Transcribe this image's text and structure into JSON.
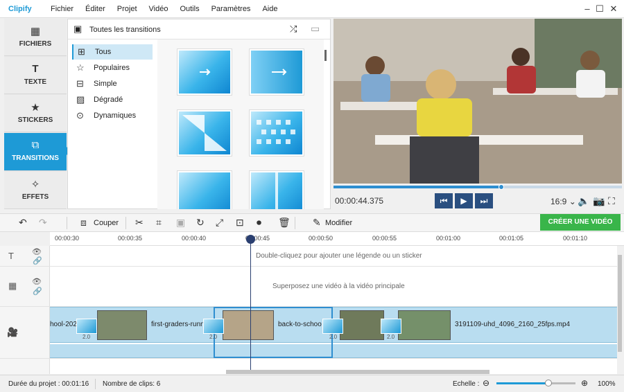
{
  "app": {
    "logo": "Clipify"
  },
  "menu": [
    "Fichier",
    "Éditer",
    "Projet",
    "Vidéo",
    "Outils",
    "Paramètres",
    "Aide"
  ],
  "tabs": [
    {
      "label": "FICHIERS",
      "icon": "image-icon"
    },
    {
      "label": "TEXTE",
      "icon": "text-icon"
    },
    {
      "label": "STICKERS",
      "icon": "star-icon"
    },
    {
      "label": "TRANSITIONS",
      "icon": "transitions-icon",
      "active": true
    },
    {
      "label": "EFFETS",
      "icon": "magic-wand-icon"
    }
  ],
  "panel": {
    "title": "Toutes les transitions"
  },
  "categories": [
    {
      "label": "Tous",
      "active": true
    },
    {
      "label": "Populaires"
    },
    {
      "label": "Simple"
    },
    {
      "label": "Dégradé"
    },
    {
      "label": "Dynamiques"
    }
  ],
  "player": {
    "timecode": "00:00:44.375",
    "ratio": "16:9",
    "progress": 0.58
  },
  "toolbar": {
    "cut": "Couper",
    "modify": "Modifier",
    "create": "CRÉER UNE VIDÉO"
  },
  "ruler": [
    "00:00:30",
    "00:00:35",
    "00:00:40",
    "00:00:45",
    "00:00:50",
    "00:00:55",
    "00:01:00",
    "00:01:05",
    "00:01:10"
  ],
  "timeline": {
    "caption_hint": "Double-cliquez pour ajouter une légende ou un sticker",
    "overlay_hint": "Superposez une vidéo à la vidéo principale",
    "clips": [
      "hool-202",
      "first-graders-runn",
      "back-to-schoo",
      "3191109-uhd_4096_2160_25fps.mp4"
    ],
    "transition_durations": [
      "2.0",
      "2.0",
      "2.0",
      "2.0"
    ]
  },
  "status": {
    "duration": "Durée du projet :  00:01:16",
    "clips": "Nombre de clips: 6",
    "scale": "Echelle :",
    "zoom": "100%"
  }
}
